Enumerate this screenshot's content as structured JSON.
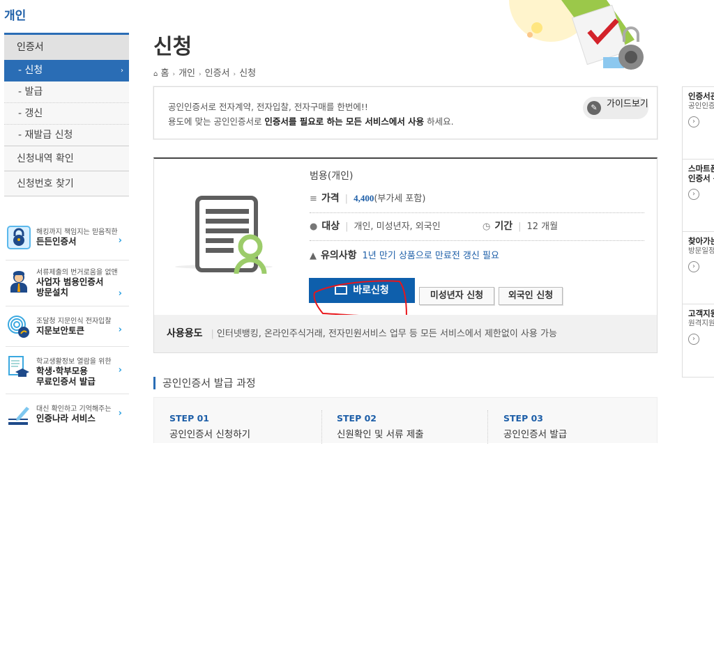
{
  "section_title": "개인",
  "lnb": {
    "head": "인증서",
    "items": [
      "- 신청",
      "- 발급",
      "- 갱신",
      "- 재발급 신청"
    ],
    "active_arrow": "›",
    "extra": [
      "신청내역 확인",
      "신청번호 찾기"
    ]
  },
  "promos": [
    {
      "small": "해킹까지 책임지는 믿음직한",
      "big": [
        "든든인증서"
      ],
      "icon": "lock-icon"
    },
    {
      "small": "서류제출의 번거로움을 없앤",
      "big": [
        "사업자 범용인증서",
        "방문설치"
      ],
      "icon": "agent-icon"
    },
    {
      "small": "조달청 지문인식 전자입찰",
      "big": [
        "지문보안토큰"
      ],
      "icon": "fingerprint-icon"
    },
    {
      "small": "학교생활정보 열람을 위한",
      "big": [
        "학생·학부모용",
        "무료인증서  발급"
      ],
      "icon": "graduation-doc-icon"
    },
    {
      "small": "대신 확인하고 기억해주는",
      "big": [
        "인증나라 서비스"
      ],
      "icon": "pen-book-icon"
    }
  ],
  "page_title": "신청",
  "breadcrumb": [
    "홈",
    "개인",
    "인증서",
    "신청"
  ],
  "info": {
    "line1": "공인인증서로 전자계약, 전자입찰, 전자구매를 한번에!!",
    "line2_pre": "용도에 맞는 공인인증서로 ",
    "line2_bold": "인증서를 필요로 하는 모든 서비스에서 사용",
    "line2_post": " 하세요.",
    "guide": "가이드보기"
  },
  "product": {
    "name": "범용(개인)",
    "price_label": "가격",
    "price": "4,400",
    "price_note": "(부가세 포함)",
    "target_label": "대상",
    "target": "개인, 미성년자, 외국인",
    "period_label": "기간",
    "period": "12 개월",
    "notice_label": "유의사항",
    "notice": "1년 만기 상품으로 만료전 갱신 필요",
    "btn_apply": "바로신청",
    "btn_minor": "미성년자 신청",
    "btn_foreign": "외국인 신청",
    "usage_label": "사용용도",
    "usage": "인터넷뱅킹, 온라인주식거래, 전자민원서비스 업무 등 모든 서비스에서 제한없이 사용 가능"
  },
  "process": {
    "title": "공인인증서 발급 과정",
    "steps": [
      {
        "no": "STEP 01",
        "text": "공인인증서 신청하기"
      },
      {
        "no": "STEP 02",
        "text": "신원확인 및 서류 제출"
      },
      {
        "no": "STEP 03",
        "text": "공인인증서 발급"
      }
    ]
  },
  "quick": [
    {
      "t": "인증서관",
      "s": "공인인증"
    },
    {
      "t": "스마트폰",
      "s": "인증서 복"
    },
    {
      "t": "찾아가는",
      "s": "방문일정"
    },
    {
      "t": "고객지원",
      "s": "원격지원"
    }
  ],
  "colors": {
    "accent": "#2a6db5",
    "button": "#0e5fac",
    "annotation": "#e8161b"
  }
}
